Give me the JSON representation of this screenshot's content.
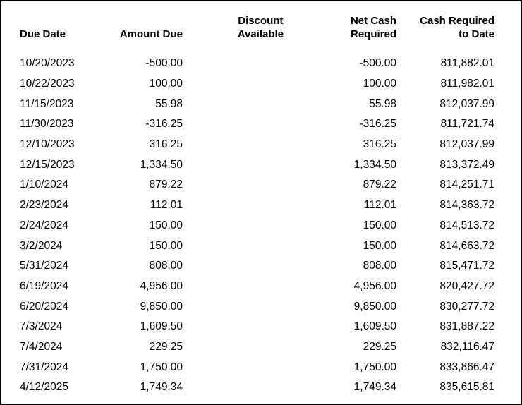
{
  "headers": {
    "due_date": "Due Date",
    "amount_due": "Amount Due",
    "discount_line1": "Discount",
    "discount_line2": "Available",
    "net_cash_line1": "Net Cash",
    "net_cash_line2": "Required",
    "cash_to_date_line1": "Cash Required",
    "cash_to_date_line2": "to Date"
  },
  "rows": [
    {
      "date": "10/20/2023",
      "amount": "-500.00",
      "discount": "",
      "net": "-500.00",
      "to_date": "811,882.01"
    },
    {
      "date": "10/22/2023",
      "amount": "100.00",
      "discount": "",
      "net": "100.00",
      "to_date": "811,982.01"
    },
    {
      "date": "11/15/2023",
      "amount": "55.98",
      "discount": "",
      "net": "55.98",
      "to_date": "812,037.99"
    },
    {
      "date": "11/30/2023",
      "amount": "-316.25",
      "discount": "",
      "net": "-316.25",
      "to_date": "811,721.74"
    },
    {
      "date": "12/10/2023",
      "amount": "316.25",
      "discount": "",
      "net": "316.25",
      "to_date": "812,037.99"
    },
    {
      "date": "12/15/2023",
      "amount": "1,334.50",
      "discount": "",
      "net": "1,334.50",
      "to_date": "813,372.49"
    },
    {
      "date": "1/10/2024",
      "amount": "879.22",
      "discount": "",
      "net": "879.22",
      "to_date": "814,251.71"
    },
    {
      "date": "2/23/2024",
      "amount": "112.01",
      "discount": "",
      "net": "112.01",
      "to_date": "814,363.72"
    },
    {
      "date": "2/24/2024",
      "amount": "150.00",
      "discount": "",
      "net": "150.00",
      "to_date": "814,513.72"
    },
    {
      "date": "3/2/2024",
      "amount": "150.00",
      "discount": "",
      "net": "150.00",
      "to_date": "814,663.72"
    },
    {
      "date": "5/31/2024",
      "amount": "808.00",
      "discount": "",
      "net": "808.00",
      "to_date": "815,471.72"
    },
    {
      "date": "6/19/2024",
      "amount": "4,956.00",
      "discount": "",
      "net": "4,956.00",
      "to_date": "820,427.72"
    },
    {
      "date": "6/20/2024",
      "amount": "9,850.00",
      "discount": "",
      "net": "9,850.00",
      "to_date": "830,277.72"
    },
    {
      "date": "7/3/2024",
      "amount": "1,609.50",
      "discount": "",
      "net": "1,609.50",
      "to_date": "831,887.22"
    },
    {
      "date": "7/4/2024",
      "amount": "229.25",
      "discount": "",
      "net": "229.25",
      "to_date": "832,116.47"
    },
    {
      "date": "7/31/2024",
      "amount": "1,750.00",
      "discount": "",
      "net": "1,750.00",
      "to_date": "833,866.47"
    },
    {
      "date": "4/12/2025",
      "amount": "1,749.34",
      "discount": "",
      "net": "1,749.34",
      "to_date": "835,615.81"
    }
  ]
}
